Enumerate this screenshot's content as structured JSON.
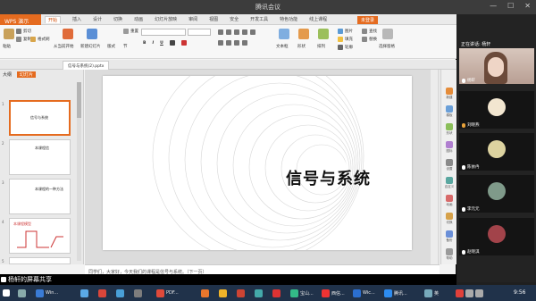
{
  "window": {
    "title": "腾讯会议",
    "controls": [
      "—",
      "☐",
      "✕"
    ]
  },
  "wps": {
    "logo": "WPS 演示",
    "tabs": [
      "开始",
      "插入",
      "设计",
      "切换",
      "动画",
      "幻灯片放映",
      "审阅",
      "视图",
      "安全",
      "开发工具",
      "特色功能",
      "线上课程"
    ],
    "active_tab": "开始",
    "unlogged": "未登录",
    "ribbon": {
      "paste": "粘贴",
      "cut": "剪切",
      "copy": "复制",
      "format_painter": "格式刷",
      "from_current": "从当前开始",
      "new_slide": "新建幻灯片",
      "layout": "版式",
      "reset": "重置",
      "section": "节",
      "font_value": "",
      "size_value": "",
      "bold": "B",
      "italic": "I",
      "underline": "U",
      "textbox": "文本框",
      "shape": "形状",
      "arrange": "排列",
      "image": "图片",
      "find": "查找",
      "replace": "替换",
      "select_pane": "选择窗格",
      "fill": "填充",
      "outline": "轮廓"
    },
    "doc_tab": "信号与系统(2).pptx",
    "panel_tabs": [
      "大纲",
      "幻灯片"
    ],
    "thumbs": [
      {
        "num": "1",
        "text": "信号与系统"
      },
      {
        "num": "2",
        "text": "本课程信"
      },
      {
        "num": "3",
        "text": "本课程的一种方法"
      },
      {
        "num": "4",
        "text": "本课程模型"
      },
      {
        "num": "5",
        "text": ""
      }
    ],
    "slide_title": "信号与系统",
    "right_tools": [
      "新建",
      "模板",
      "形状",
      "图标",
      "设置",
      "自定义",
      "动画",
      "切换",
      "备份",
      "帮助"
    ],
    "notes": "同学们，大家好，今天我们的课程是信号与系统。（下一页）",
    "status_left": "幻灯片 1 / 11",
    "status_theme": "Office 主题",
    "zoom": "72 %"
  },
  "meeting": {
    "header": "正在讲话: 杨轩",
    "participants": [
      {
        "name": "杨轩"
      },
      {
        "name": "刘晓燕"
      },
      {
        "name": "陈依冉"
      },
      {
        "name": "李元元"
      },
      {
        "name": "赵晓淇"
      }
    ],
    "share_label": "杨轩的屏幕共享"
  },
  "taskbar": {
    "items": [
      "Win...",
      "PDF...",
      "宝山...",
      "西信...",
      "Wic...",
      "腾讯..."
    ],
    "time": "9:56",
    "lang": "英",
    "date": ""
  },
  "colors": {
    "accent": "#e56b1f",
    "taskbar": "#20324a"
  }
}
